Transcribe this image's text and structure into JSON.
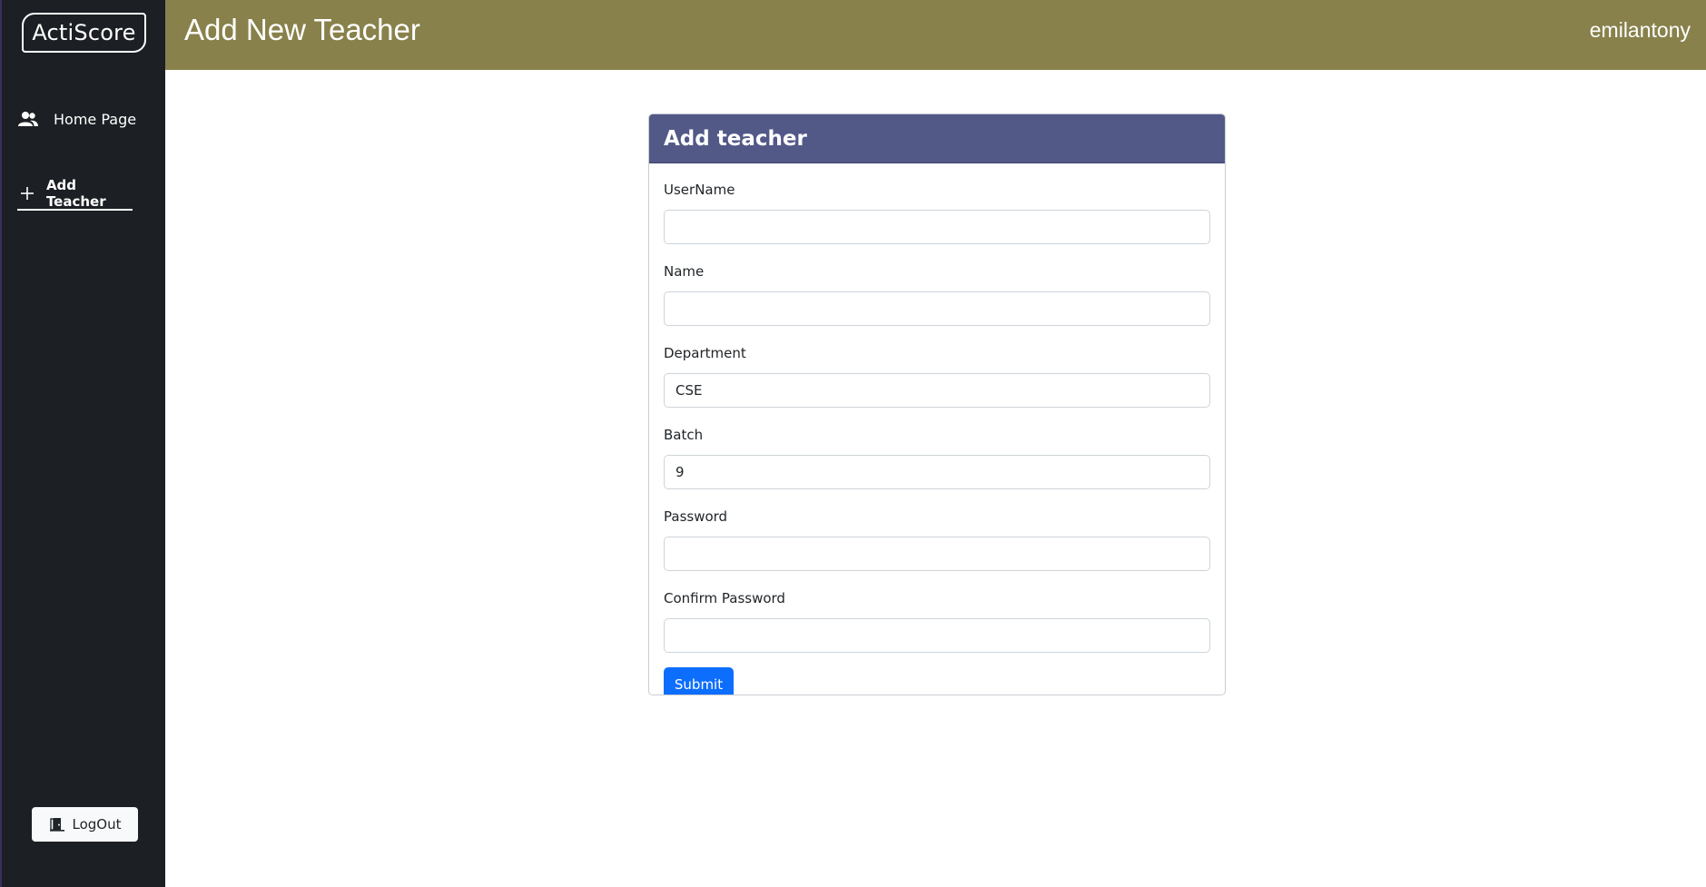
{
  "sidebar": {
    "logo": "ActiScore",
    "items": [
      {
        "label": "Home Page",
        "icon": "users-icon"
      },
      {
        "label": "Add Teacher",
        "icon": "plus-icon"
      }
    ],
    "logout_label": "LogOut"
  },
  "header": {
    "title": "Add New Teacher",
    "username": "emilantony"
  },
  "form": {
    "title": "Add teacher",
    "fields": [
      {
        "label": "UserName",
        "value": ""
      },
      {
        "label": "Name",
        "value": ""
      },
      {
        "label": "Department",
        "value": "CSE"
      },
      {
        "label": "Batch",
        "value": "9"
      },
      {
        "label": "Password",
        "value": ""
      },
      {
        "label": "Confirm Password",
        "value": ""
      }
    ],
    "submit_label": "Submit"
  },
  "colors": {
    "sidebar_bg": "#1c1f23",
    "header_bg": "#88814b",
    "card_header_bg": "#525987",
    "primary": "#0d6efd"
  }
}
